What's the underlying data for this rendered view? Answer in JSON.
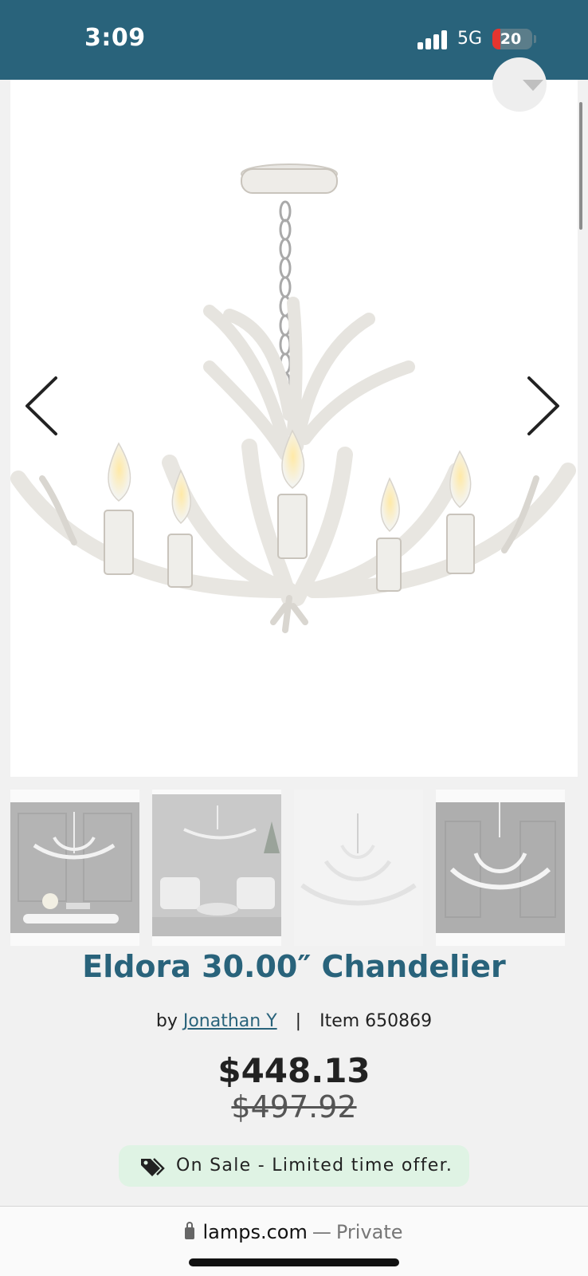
{
  "status_bar": {
    "time": "3:09",
    "network": "5G",
    "battery_level": "20",
    "battery_fraction": 0.2,
    "background": "#29637b"
  },
  "hero": {
    "favorite_icon": "heart-icon",
    "prev_icon": "chevron-left-icon",
    "next_icon": "chevron-right-icon"
  },
  "thumbnails": [
    {
      "name": "thumbnail-dining-room"
    },
    {
      "name": "thumbnail-living-room"
    },
    {
      "name": "thumbnail-product-white"
    },
    {
      "name": "thumbnail-product-gray"
    }
  ],
  "product": {
    "title": "Eldora 30.00″ Chandelier",
    "by_label": "by",
    "brand": "Jonathan Y",
    "divider": "|",
    "item_label": "Item 650869",
    "price": "$448.13",
    "old_price": "$497.92",
    "sale_icon": "tag-icon",
    "sale_text": "On Sale - Limited time offer.",
    "accent_color": "#29637b",
    "sale_bg_color": "#dff3e4"
  },
  "browser": {
    "domain": "lamps.com",
    "separator": "—",
    "privacy": "Private"
  }
}
